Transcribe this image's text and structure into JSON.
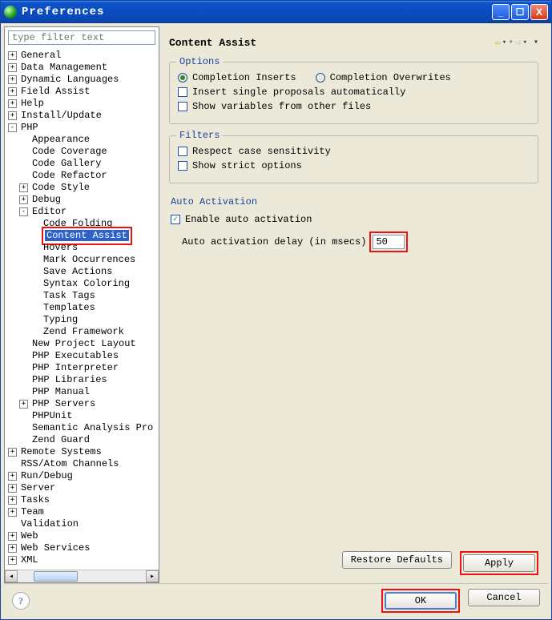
{
  "window": {
    "title": "Preferences"
  },
  "sidebar": {
    "filter_placeholder": "type filter text",
    "items": {
      "general": "General",
      "data_management": "Data Management",
      "dynamic_languages": "Dynamic Languages",
      "field_assist": "Field Assist",
      "help": "Help",
      "install_update": "Install/Update",
      "php": "PHP",
      "appearance": "Appearance",
      "code_coverage": "Code Coverage",
      "code_gallery": "Code Gallery",
      "code_refactor": "Code Refactor",
      "code_style": "Code Style",
      "debug": "Debug",
      "editor": "Editor",
      "code_folding": "Code Folding",
      "content_assist": "Content Assist",
      "hovers": "Hovers",
      "mark_occurrences": "Mark Occurrences",
      "save_actions": "Save Actions",
      "syntax_coloring": "Syntax Coloring",
      "task_tags": "Task Tags",
      "templates": "Templates",
      "typing": "Typing",
      "zend_framework": "Zend Framework",
      "new_project_layout": "New Project Layout",
      "php_executables": "PHP Executables",
      "php_interpreter": "PHP Interpreter",
      "php_libraries": "PHP Libraries",
      "php_manual": "PHP Manual",
      "php_servers": "PHP Servers",
      "phpunit": "PHPUnit",
      "semantic_analysis": "Semantic Analysis Pro",
      "zend_guard": "Zend Guard",
      "remote_systems": "Remote Systems",
      "rss_atom": "RSS/Atom Channels",
      "run_debug": "Run/Debug",
      "server": "Server",
      "tasks": "Tasks",
      "team": "Team",
      "validation": "Validation",
      "web": "Web",
      "web_services": "Web Services",
      "xml": "XML"
    }
  },
  "content": {
    "title": "Content Assist",
    "groups": {
      "options": {
        "legend": "Options",
        "completion_inserts": "Completion Inserts",
        "completion_overwrites": "Completion Overwrites",
        "insert_single": "Insert single proposals automatically",
        "show_variables": "Show variables from other files"
      },
      "filters": {
        "legend": "Filters",
        "respect_case": "Respect case sensitivity",
        "strict": "Show strict options"
      },
      "auto_activation": {
        "legend": "Auto Activation",
        "enable": "Enable auto activation",
        "delay_label": "Auto activation delay (in msecs)",
        "delay_value": "50"
      }
    },
    "buttons": {
      "restore": "Restore Defaults",
      "apply": "Apply",
      "ok": "OK",
      "cancel": "Cancel"
    }
  }
}
